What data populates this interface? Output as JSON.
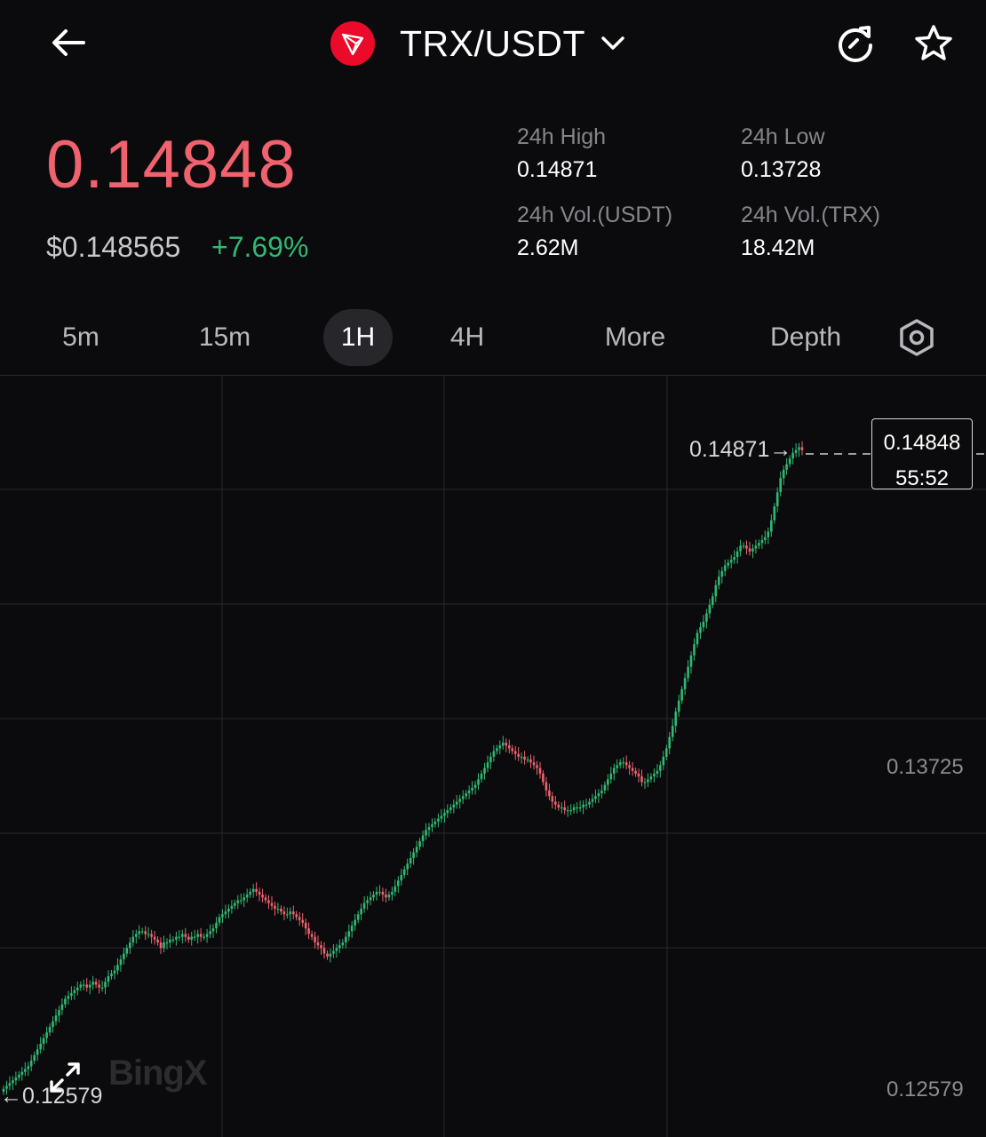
{
  "header": {
    "pair": "TRX/USDT",
    "icons": {
      "back": "arrow-left-icon",
      "logo": "tron-logo-icon",
      "dropdown": "chevron-down-icon",
      "refresh": "refresh-icon",
      "favorite": "star-icon"
    }
  },
  "ticker": {
    "last_price": "0.14848",
    "usd_price": "$0.148565",
    "change_pct": "+7.69%",
    "stats": [
      {
        "label": "24h High",
        "value": "0.14871"
      },
      {
        "label": "24h Low",
        "value": "0.13728"
      },
      {
        "label": "24h Vol.(USDT)",
        "value": "2.62M"
      },
      {
        "label": "24h Vol.(TRX)",
        "value": "18.42M"
      }
    ]
  },
  "tabs": [
    {
      "label": "5m",
      "active": false
    },
    {
      "label": "15m",
      "active": false
    },
    {
      "label": "1H",
      "active": true
    },
    {
      "label": "4H",
      "active": false
    },
    {
      "label": "More",
      "active": false
    },
    {
      "label": "Depth",
      "active": false
    }
  ],
  "chart": {
    "price_tag": {
      "price": "0.14848",
      "countdown": "55:52"
    },
    "high_marker": "0.14871→",
    "low_marker": "←0.12579",
    "axis_labels": [
      "0.13725",
      "0.12579"
    ],
    "watermark": "BingX",
    "colors": {
      "up": "#31b872",
      "down": "#f0626d",
      "grid": "#2a2a2e"
    }
  },
  "chart_data": {
    "type": "line",
    "series_style": "candlestick",
    "interval": "1H",
    "x": [
      0,
      1,
      2,
      3,
      4,
      5,
      6,
      7,
      8,
      9,
      10,
      11,
      12,
      13,
      14,
      15,
      16,
      17,
      18,
      19,
      20,
      21,
      22,
      23,
      24,
      25,
      26,
      27,
      28,
      29,
      30,
      31,
      32,
      33,
      34,
      35,
      36,
      37,
      38,
      39,
      40,
      41,
      42,
      43,
      44,
      45,
      46,
      47,
      48,
      49,
      50,
      51,
      52,
      53,
      54,
      55,
      56,
      57,
      58,
      59,
      60,
      61,
      62,
      63,
      64,
      65,
      66,
      67,
      68,
      69,
      70,
      71,
      72,
      73,
      74,
      75,
      76,
      77,
      78,
      79,
      80,
      81,
      82,
      83,
      84,
      85,
      86,
      87,
      88,
      89,
      90,
      91,
      92,
      93,
      94,
      95,
      96,
      97,
      98,
      99,
      100,
      101,
      102,
      103,
      104,
      105,
      106,
      107,
      108,
      109,
      110,
      111,
      112,
      113,
      114,
      115,
      116,
      117,
      118,
      119,
      120,
      121,
      122,
      123,
      124,
      125,
      126,
      127,
      128,
      129,
      130,
      131,
      132,
      133,
      134,
      135,
      136,
      137,
      138,
      139,
      140,
      141,
      142,
      143,
      144,
      145,
      146,
      147,
      148,
      149,
      150,
      151,
      152,
      153,
      154,
      155,
      156,
      157,
      158,
      159,
      160,
      161,
      162,
      163,
      164,
      165,
      166,
      167,
      168,
      169,
      170,
      171,
      172,
      173,
      174,
      175,
      176,
      177,
      178,
      179,
      180,
      181,
      182,
      183,
      184,
      185,
      186,
      187,
      188,
      189,
      190,
      191,
      192,
      193,
      194,
      195,
      196,
      197,
      198,
      199,
      200,
      201,
      202,
      203,
      204,
      205,
      206,
      207,
      208,
      209,
      210,
      211,
      212,
      213,
      214,
      215,
      216,
      217,
      218,
      219,
      220,
      221,
      222,
      223,
      224,
      225,
      226,
      227,
      228,
      229,
      230,
      231,
      232,
      233,
      234,
      235,
      236,
      237,
      238,
      239,
      240,
      241,
      242,
      243,
      244,
      245,
      246,
      247,
      248,
      249,
      250,
      251,
      252,
      253,
      254,
      255,
      256,
      257,
      258,
      259
    ],
    "close": [
      0.1258,
      0.1259,
      0.126,
      0.1261,
      0.1262,
      0.1263,
      0.1264,
      0.1265,
      0.1266,
      0.1268,
      0.127,
      0.1272,
      0.1274,
      0.1276,
      0.1278,
      0.128,
      0.1282,
      0.1284,
      0.1286,
      0.1288,
      0.129,
      0.1291,
      0.1292,
      0.1293,
      0.1294,
      0.1295,
      0.1295,
      0.1294,
      0.1295,
      0.1296,
      0.1295,
      0.1294,
      0.1294,
      0.1296,
      0.1298,
      0.1299,
      0.13,
      0.1302,
      0.1304,
      0.1306,
      0.1308,
      0.131,
      0.1312,
      0.1313,
      0.1314,
      0.1314,
      0.1313,
      0.1313,
      0.1312,
      0.1311,
      0.131,
      0.1308,
      0.131,
      0.131,
      0.1311,
      0.1311,
      0.1312,
      0.1312,
      0.1313,
      0.1312,
      0.1311,
      0.1312,
      0.1312,
      0.1313,
      0.1312,
      0.1312,
      0.1313,
      0.1314,
      0.1315,
      0.1317,
      0.1319,
      0.132,
      0.1321,
      0.1322,
      0.1323,
      0.1324,
      0.1325,
      0.1325,
      0.1326,
      0.1327,
      0.1328,
      0.1329,
      0.1328,
      0.1327,
      0.1326,
      0.1325,
      0.1324,
      0.1323,
      0.1322,
      0.1322,
      0.1321,
      0.132,
      0.132,
      0.1321,
      0.132,
      0.1319,
      0.1318,
      0.1317,
      0.1315,
      0.1313,
      0.1312,
      0.131,
      0.1309,
      0.1308,
      0.1306,
      0.1305,
      0.1306,
      0.1307,
      0.1308,
      0.1309,
      0.131,
      0.1312,
      0.1314,
      0.1316,
      0.1318,
      0.132,
      0.1322,
      0.1324,
      0.1325,
      0.1326,
      0.1327,
      0.1328,
      0.1328,
      0.1327,
      0.1326,
      0.1327,
      0.1328,
      0.133,
      0.1332,
      0.1334,
      0.1336,
      0.1338,
      0.134,
      0.1342,
      0.1344,
      0.1346,
      0.1348,
      0.135,
      0.1351,
      0.1352,
      0.1353,
      0.1354,
      0.1355,
      0.1356,
      0.1357,
      0.1358,
      0.1359,
      0.136,
      0.1361,
      0.1362,
      0.1363,
      0.1364,
      0.1365,
      0.1366,
      0.1368,
      0.137,
      0.1372,
      0.1374,
      0.1376,
      0.1378,
      0.1379,
      0.138,
      0.1381,
      0.138,
      0.1379,
      0.1378,
      0.1377,
      0.1376,
      0.1376,
      0.1375,
      0.1375,
      0.1374,
      0.1373,
      0.1372,
      0.137,
      0.1367,
      0.1364,
      0.1362,
      0.136,
      0.1359,
      0.1358,
      0.1358,
      0.1357,
      0.1357,
      0.1357,
      0.1358,
      0.1358,
      0.1358,
      0.1359,
      0.1359,
      0.136,
      0.1361,
      0.1362,
      0.1363,
      0.1364,
      0.1366,
      0.1368,
      0.137,
      0.1372,
      0.1373,
      0.1374,
      0.1374,
      0.1373,
      0.1372,
      0.1371,
      0.137,
      0.1369,
      0.1367,
      0.1367,
      0.1368,
      0.1369,
      0.137,
      0.1371,
      0.1373,
      0.1376,
      0.1379,
      0.1383,
      0.1387,
      0.1392,
      0.1396,
      0.14,
      0.1404,
      0.1408,
      0.1412,
      0.1416,
      0.142,
      0.1422,
      0.1424,
      0.1427,
      0.143,
      0.1433,
      0.1437,
      0.144,
      0.1442,
      0.1444,
      0.1445,
      0.1446,
      0.1447,
      0.1449,
      0.1451,
      0.1451,
      0.145,
      0.1449,
      0.145,
      0.1451,
      0.1452,
      0.1453,
      0.1454,
      0.1456,
      0.146,
      0.1465,
      0.147,
      0.1475,
      0.1478,
      0.148,
      0.1482,
      0.1484,
      0.1485,
      0.1486,
      0.1485
    ]
  }
}
